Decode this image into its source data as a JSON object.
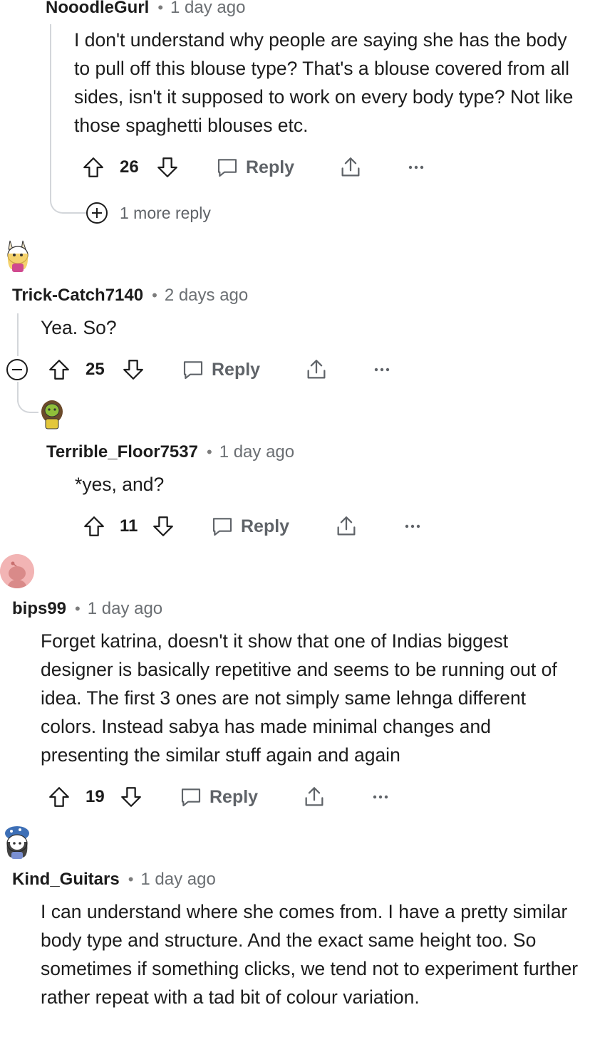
{
  "comments": [
    {
      "username": "NooodleGurl",
      "separator": "•",
      "time": "1 day ago",
      "body": "I don't understand why people are saying she has the body to pull off this blouse type? That's a blouse covered from all sides, isn't it supposed to work on every body type? Not like those spaghetti blouses etc.",
      "votes": "26",
      "reply_label": "Reply",
      "more_replies": "1 more reply"
    },
    {
      "username": "Trick-Catch7140",
      "separator": "•",
      "time": "2 days ago",
      "body": "Yea. So?",
      "votes": "25",
      "reply_label": "Reply"
    },
    {
      "username": "Terrible_Floor7537",
      "separator": "•",
      "time": "1 day ago",
      "body": "*yes, and?",
      "votes": "11",
      "reply_label": "Reply"
    },
    {
      "username": "bips99",
      "separator": "•",
      "time": "1 day ago",
      "body": "Forget katrina, doesn't it show that one of Indias biggest designer is basically repetitive and seems to be running out of idea. The first 3 ones are not simply same lehnga different colors. Instead sabya has made minimal changes and presenting the similar stuff again and again",
      "votes": "19",
      "reply_label": "Reply"
    },
    {
      "username": "Kind_Guitars",
      "separator": "•",
      "time": "1 day ago",
      "body": "I can understand where she comes from. I have a pretty similar body type and structure. And the exact same height too. So sometimes if something clicks, we tend not to experiment further rather repeat with a tad bit of colour variation."
    }
  ],
  "icons": {
    "upvote": "upvote-arrow-icon",
    "downvote": "downvote-arrow-icon",
    "reply": "speech-bubble-icon",
    "share": "share-icon",
    "overflow": "more-options-icon",
    "expand": "plus-circle-icon",
    "collapse": "minus-circle-icon"
  },
  "colors": {
    "text": "#1c1c1c",
    "muted": "#6b6f73",
    "thread_line": "#d3d6da",
    "bips_avatar_bg": "#f2b4b4"
  }
}
